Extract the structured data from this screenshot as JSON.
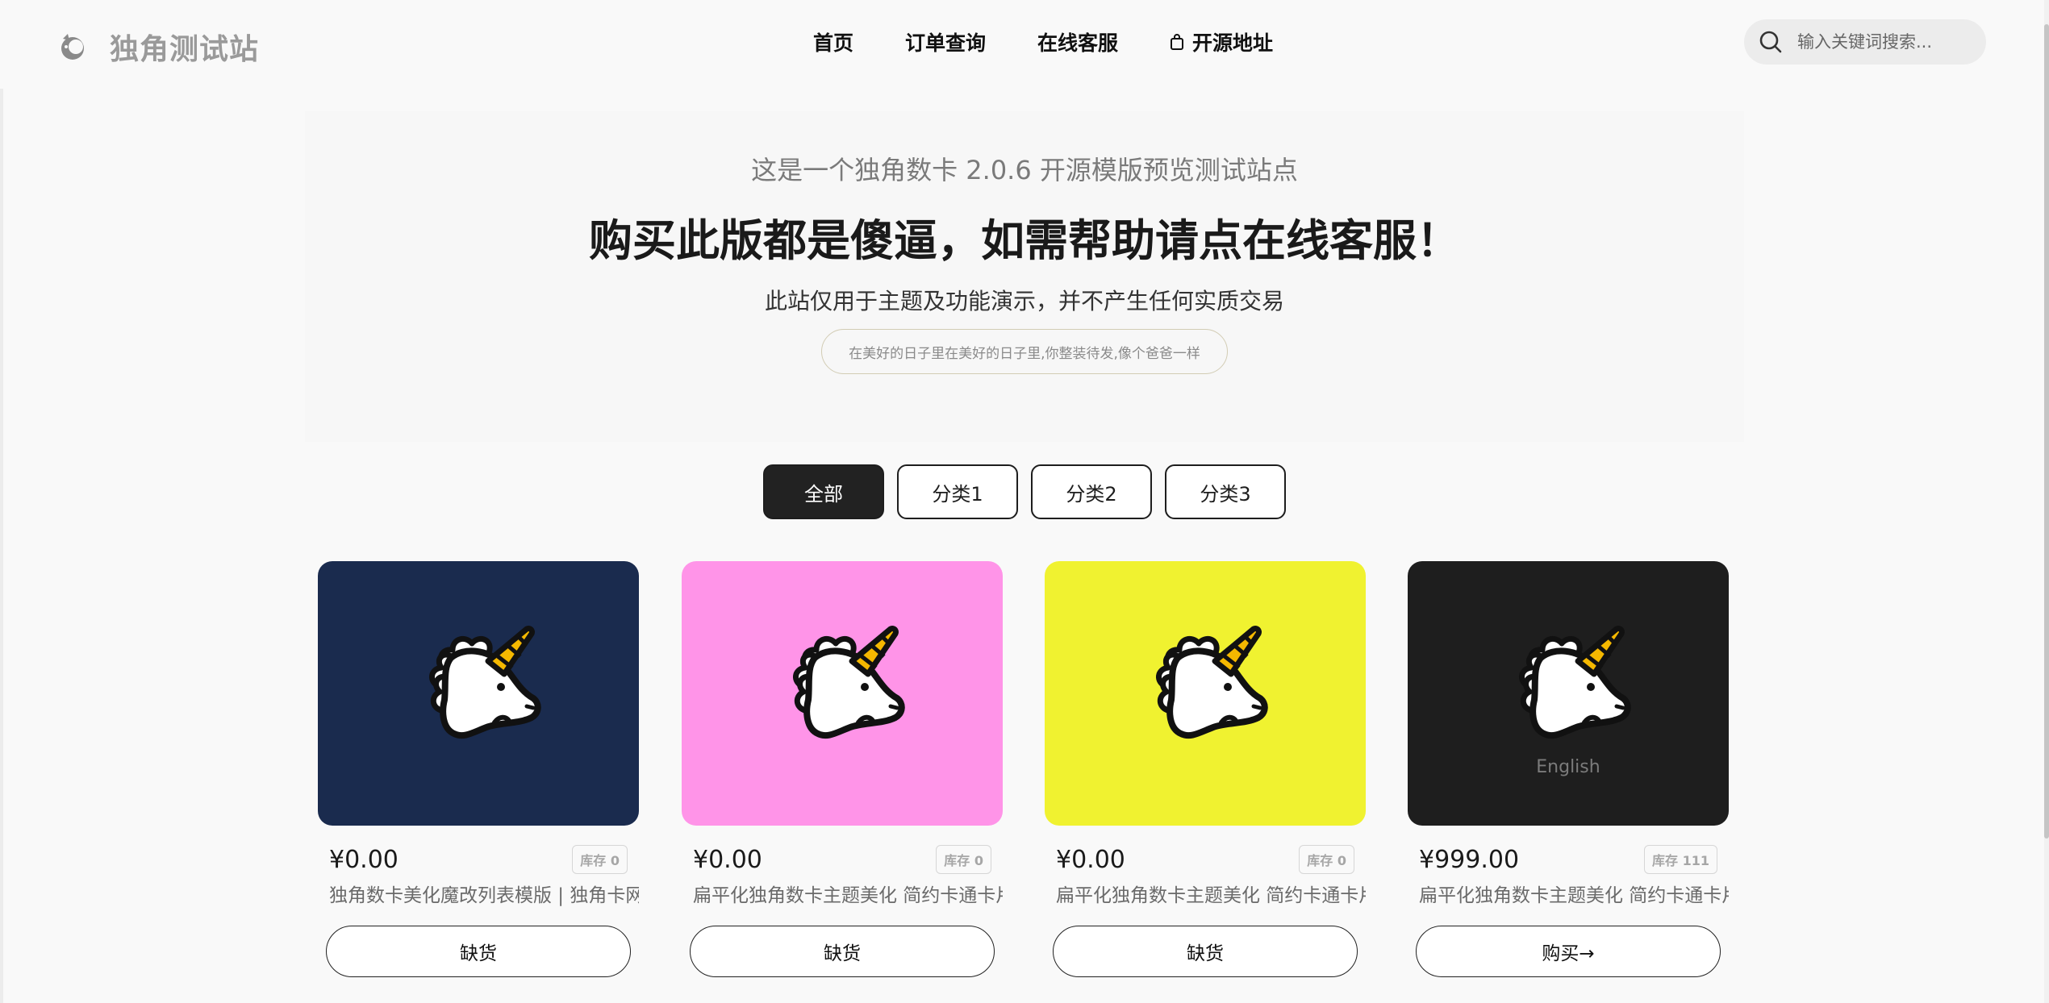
{
  "header": {
    "site_name": "独角测试站",
    "nav": [
      {
        "label": "首页"
      },
      {
        "label": "订单查询"
      },
      {
        "label": "在线客服"
      },
      {
        "label": "开源地址"
      }
    ],
    "search_placeholder": "输入关键词搜索..."
  },
  "hero": {
    "subtitle": "这是一个独角数卡 2.0.6 开源模版预览测试站点",
    "title": "购买此版都是傻逼，如需帮助请点在线客服！",
    "description": "此站仅用于主题及功能演示，并不产生任何实质交易",
    "quote": "在美好的日子里在美好的日子里,你整装待发,像个爸爸一样"
  },
  "categories": [
    {
      "label": "全部",
      "active": true
    },
    {
      "label": "分类1",
      "active": false
    },
    {
      "label": "分类2",
      "active": false
    },
    {
      "label": "分类3",
      "active": false
    }
  ],
  "products": [
    {
      "bg": "#1a2b4e",
      "price": "¥0.00",
      "stock": "库存 0",
      "title": "独角数卡美化魔改列表模版 | 独角卡网美化",
      "button": "缺货",
      "caption": ""
    },
    {
      "bg": "#ff94e8",
      "price": "¥0.00",
      "stock": "库存 0",
      "title": "扁平化独角数卡主题美化 简约卡通卡片式",
      "button": "缺货",
      "caption": ""
    },
    {
      "bg": "#f0f230",
      "price": "¥0.00",
      "stock": "库存 0",
      "title": "扁平化独角数卡主题美化 简约卡通卡片式",
      "button": "缺货",
      "caption": ""
    },
    {
      "bg": "#1e1e1e",
      "price": "¥999.00",
      "stock": "库存 111",
      "title": "扁平化独角数卡主题美化 简约卡通卡片式",
      "button": "购买→",
      "caption": "English"
    }
  ],
  "colors": {
    "horn": "#f5b800",
    "accent_dark": "#222222"
  }
}
